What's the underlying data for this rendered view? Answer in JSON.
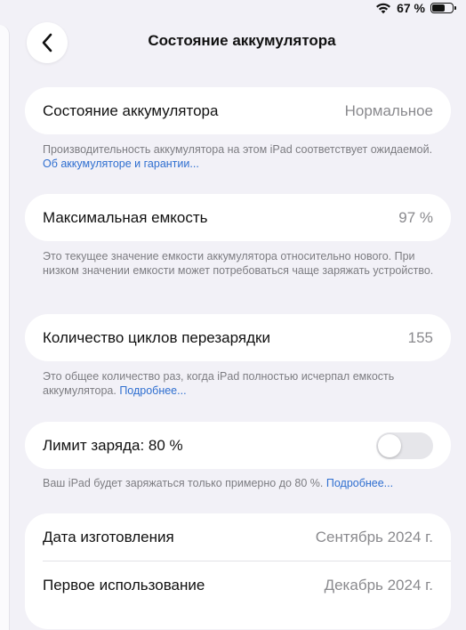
{
  "status_bar": {
    "battery_percent_text": "67 %",
    "battery_level": 0.67
  },
  "nav": {
    "title": "Состояние аккумулятора"
  },
  "battery_health": {
    "label": "Состояние аккумулятора",
    "value": "Нормальное",
    "footnote_text": "Производительность аккумулятора на этом iPad соответствует ожидаемой. ",
    "footnote_link": "Об аккумуляторе и гарантии..."
  },
  "max_capacity": {
    "label": "Максимальная емкость",
    "value": "97 %",
    "footnote_text": "Это текущее значение емкости аккумулятора относительно нового. При низком значении емкости может потребоваться чаще заряжать устройство."
  },
  "cycle_count": {
    "label": "Количество циклов перезарядки",
    "value": "155",
    "footnote_text": "Это общее количество раз, когда iPad полностью исчерпал емкость аккумулятора. ",
    "footnote_link": "Подробнее..."
  },
  "charge_limit": {
    "label": "Лимит заряда: 80 %",
    "toggle_on": false,
    "footnote_text": "Ваш iPad будет заряжаться только примерно до 80 %. ",
    "footnote_link": "Подробнее..."
  },
  "dates": {
    "manufacture_label": "Дата изготовления",
    "manufacture_value": "Сентябрь 2024 г.",
    "first_use_label": "Первое использование",
    "first_use_value": "Декабрь 2024 г."
  },
  "colors": {
    "background": "#f2f1f7",
    "link": "#2f6fd0",
    "secondary_text": "#8a8a8e"
  }
}
